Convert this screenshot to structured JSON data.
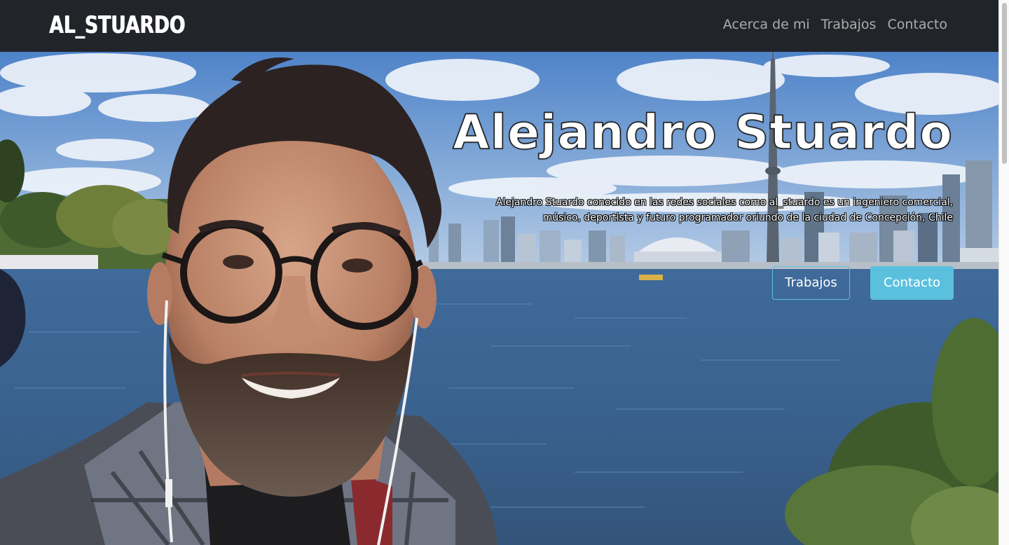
{
  "navbar": {
    "brand": "AL_STUARDO",
    "links": [
      "Acerca de mi",
      "Trabajos",
      "Contacto"
    ]
  },
  "hero": {
    "title": "Alejandro Stuardo",
    "description_line1": "Alejandro Stuardo conocido en las redes sociales como al_stuardo es un ingeniero comercial,",
    "description_line2": "músico, deportista y futuro programador oriundo de la ciudad de Concepción, Chile",
    "buttons": {
      "works": "Trabajos",
      "contact": "Contacto"
    },
    "background_image": "selfie-photo-with-city-skyline-and-lake"
  },
  "colors": {
    "navbar_bg": "#212529",
    "nav_link": "rgba(255,255,255,0.62)",
    "accent": "#5bc0de"
  }
}
